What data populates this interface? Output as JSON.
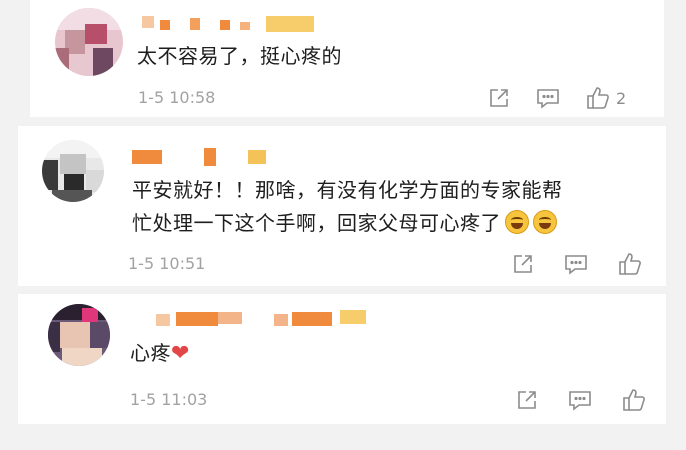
{
  "comments": [
    {
      "text": "太不容易了，挺心疼的",
      "time": "1-5 10:58",
      "likes": "2",
      "icons": [
        "share-icon",
        "reply-icon",
        "like-icon"
      ]
    },
    {
      "text_line1": "平安就好！！那啥，有没有化学方面的专家能帮",
      "text_line2": "忙处理一下这个手啊，回家父母可心疼了",
      "emoji": "laugh-cry-emoji",
      "time": "1-5 10:51",
      "icons": [
        "share-icon",
        "reply-icon",
        "like-icon"
      ]
    },
    {
      "text": "心疼",
      "heart": "❤",
      "time": "1-5 11:03",
      "icons": [
        "share-icon",
        "reply-icon",
        "like-icon"
      ]
    }
  ],
  "colors": {
    "background": "#f2f2f2",
    "card": "#ffffff",
    "text": "#1e1e1e",
    "meta": "#a2a2a2",
    "icon": "#8c8c8c",
    "heart": "#e24646",
    "name_mosaic": "#f08a3c"
  }
}
